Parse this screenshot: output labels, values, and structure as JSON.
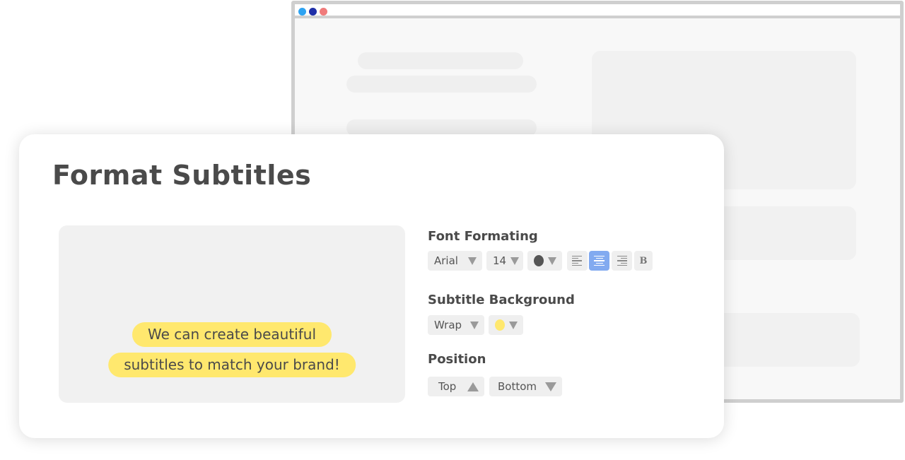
{
  "background_window": {
    "title_dots": [
      {
        "icon": "dot-icon",
        "color": "#2ea3f2"
      },
      {
        "icon": "dot-icon",
        "color": "#1f2fa8"
      },
      {
        "icon": "dot-icon",
        "color": "#f07b7b"
      }
    ]
  },
  "panel": {
    "title": "Format Subtitles"
  },
  "preview": {
    "subtitle_lines": [
      "We can create beautiful",
      "subtitles to match your brand!"
    ],
    "highlight_color": "#ffe86e"
  },
  "font_formatting": {
    "label": "Font Formating",
    "font_family": "Arial",
    "font_size": "14",
    "text_color": "#555555",
    "alignments": [
      {
        "name": "align-left",
        "icon": "align-left-icon",
        "active": false
      },
      {
        "name": "align-center",
        "icon": "align-center-icon",
        "active": true
      },
      {
        "name": "align-right",
        "icon": "align-right-icon",
        "active": false
      }
    ],
    "bold_label": "B",
    "active_color": "#82aaf0"
  },
  "subtitle_background": {
    "label": "Subtitle Background",
    "mode": "Wrap",
    "color": "#ffe86e"
  },
  "position": {
    "label": "Position",
    "top_label": "Top",
    "bottom_label": "Bottom"
  }
}
